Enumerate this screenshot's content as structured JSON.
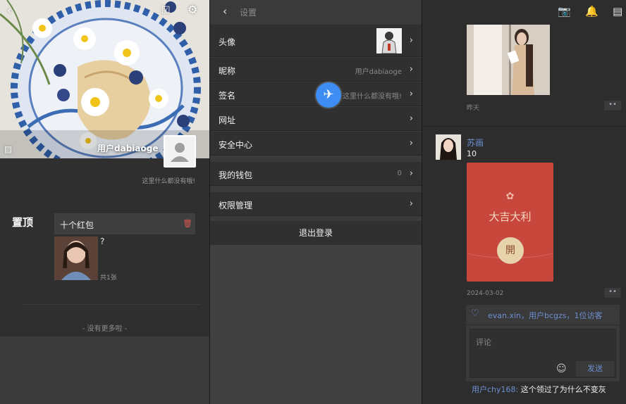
{
  "left": {
    "cover_username": "用户dabiaoge",
    "signature": "这里什么都没有哦!",
    "pin_label": "置顶",
    "redpacket_card_title": "十个红包",
    "photo_caption": "?",
    "photo_count": "共1张",
    "no_more": "- 没有更多啦 -",
    "icons": {
      "back": "chevron-left-icon",
      "calendar": "calendar-check-icon",
      "settings": "gear-icon",
      "image": "image-icon",
      "trash": "trash-icon",
      "avatar_placeholder": "user-placeholder-icon"
    }
  },
  "settings": {
    "title": "设置",
    "rows": [
      {
        "label": "头像",
        "value": ""
      },
      {
        "label": "昵称",
        "value": "用户dabiaoge"
      },
      {
        "label": "签名",
        "value": "这里什么都没有哦!"
      },
      {
        "label": "网址",
        "value": ""
      },
      {
        "label": "安全中心",
        "value": ""
      },
      {
        "label": "我的钱包",
        "value": "0"
      },
      {
        "label": "权限管理",
        "value": ""
      }
    ],
    "logout": "退出登录",
    "floating_button_icon": "airplane-icon"
  },
  "feed": {
    "post1_time": "昨天",
    "post2": {
      "author": "苏画",
      "text": "10",
      "redpacket_title": "大吉大利",
      "redpacket_open": "開",
      "date": "2024-03-02"
    },
    "likes": "evan.xin，用户bcgzs，1位访客",
    "comment_placeholder": "评论",
    "send_label": "发送",
    "comment": {
      "author": "用户chy168:",
      "text": "这个领过了为什么不变灰"
    },
    "more_label": "••",
    "icons": {
      "camera": "camera-icon",
      "bell": "bell-icon",
      "contacts": "contacts-book-icon",
      "heart": "heart-icon",
      "emoji": "emoji-icon"
    }
  },
  "colors": {
    "link_blue": "#6d8fd1",
    "redpacket": "#c7473d",
    "floating_button": "#3d8df5",
    "dark_bg": "#2f2f30"
  }
}
